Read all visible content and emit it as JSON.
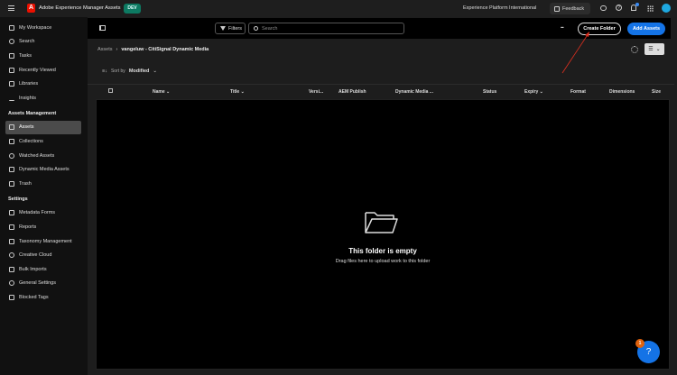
{
  "topbar": {
    "app_title": "Adobe Experience Manager Assets",
    "env_badge": "DEV",
    "org": "Experience Platform International",
    "feedback": "Feedback",
    "notification_count": ""
  },
  "sidebar": {
    "items": [
      "My Workspace",
      "Search",
      "Tasks",
      "Recently Viewed",
      "Libraries",
      "Insights"
    ],
    "section1": "Assets Management",
    "assets_items": [
      "Assets",
      "Collections",
      "Watched Assets",
      "Dynamic Media Assets",
      "Trash"
    ],
    "section2": "Settings",
    "settings_items": [
      "Metadata Forms",
      "Reports",
      "Taxonomy Management",
      "Creative Cloud",
      "Bulk Imports",
      "General Settings",
      "Blocked Tags"
    ]
  },
  "toolbar": {
    "filters": "Filters",
    "search_placeholder": "Search",
    "more": "•••",
    "create_folder": "Create Folder",
    "add_assets": "Add Assets"
  },
  "breadcrumb": {
    "root": "Assets",
    "current": "vangeluw - CitiSignal Dynamic Media"
  },
  "sort": {
    "label": "Sort by",
    "value": "Modified"
  },
  "table": {
    "columns": [
      "Name",
      "Title",
      "Versi...",
      "AEM Publish",
      "Dynamic Media ...",
      "Status",
      "Expiry",
      "Format",
      "Dimensions",
      "Size"
    ]
  },
  "empty": {
    "title": "This folder is empty",
    "subtitle": "Drag files here to upload work to this folder"
  },
  "help": {
    "badge": "1"
  },
  "colors": {
    "accent": "#1473e6",
    "dev_badge": "#0d7a62",
    "adobe_red": "#eb1000",
    "annotation": "#e03020"
  }
}
